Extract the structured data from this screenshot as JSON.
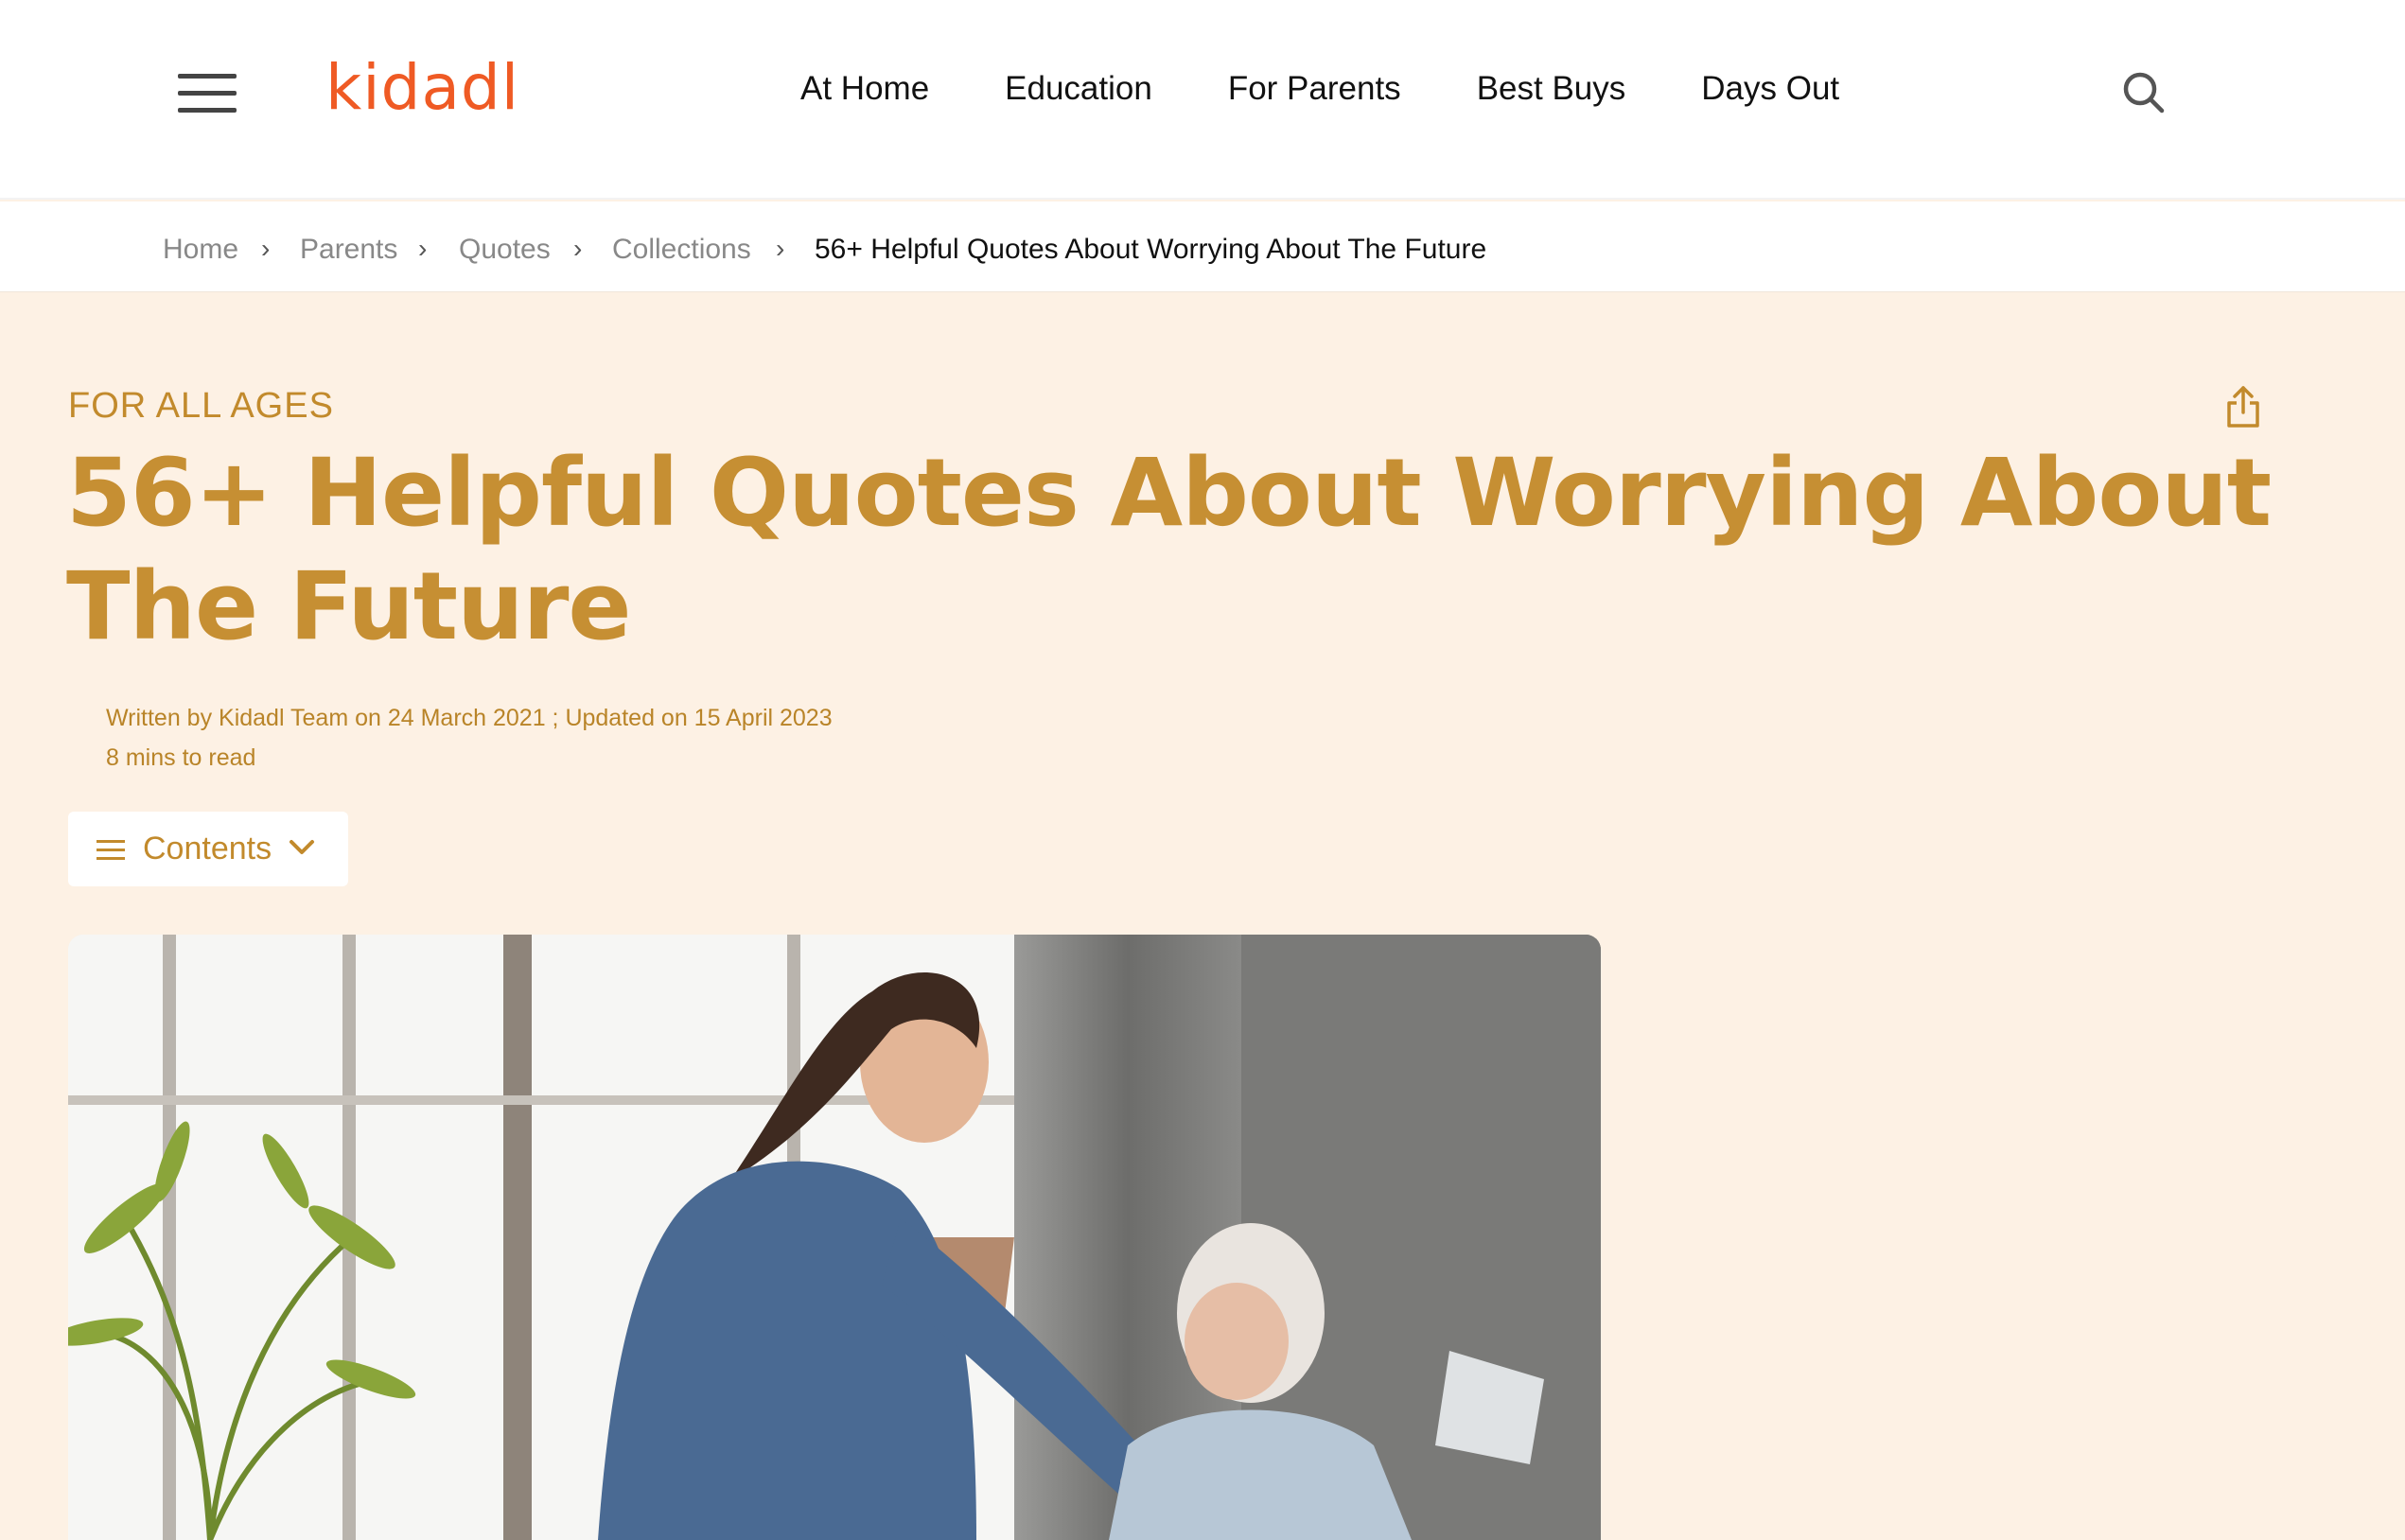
{
  "header": {
    "logo": "kidadl",
    "nav": [
      "At Home",
      "Education",
      "For Parents",
      "Best Buys",
      "Days Out"
    ]
  },
  "breadcrumb": {
    "items": [
      "Home",
      "Parents",
      "Quotes",
      "Collections"
    ],
    "separator": "›",
    "current": "56+ Helpful Quotes About Worrying About The Future"
  },
  "article": {
    "category": "FOR ALL AGES",
    "title": "56+ Helpful Quotes About Worrying About The Future",
    "byline": "Written by Kidadl Team on 24 March 2021 ; Updated on 15 April 2023",
    "read_time": "8 mins to read",
    "contents_label": "Contents"
  },
  "colors": {
    "brand": "#ef5a24",
    "accent": "#c68f33",
    "page_background": "#fdf1e4"
  },
  "icons": {
    "menu": "hamburger-menu-icon",
    "search": "search-icon",
    "share": "share-icon",
    "contents": "list-icon",
    "dropdown": "chevron-down-icon"
  }
}
